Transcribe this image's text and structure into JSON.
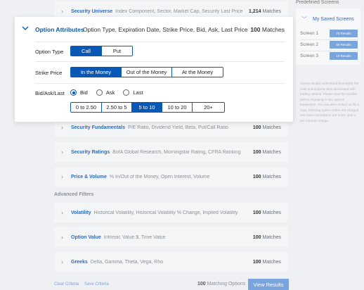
{
  "background_rows": [
    {
      "title": "Security Universe",
      "desc": "Index Component, Sector, Market Cap, Security Last Price",
      "count": "1,214",
      "count_label": "Matches"
    },
    {
      "title": "Security Fundamentals",
      "desc": "P/E Ratio, Dividend Yield, Beta, Put/Call Ratio",
      "count": "100",
      "count_label": "Matches"
    },
    {
      "title": "Security Ratings",
      "desc": "BofA Global Research, Morningstar Rating, CFRA Ranking",
      "count": "100",
      "count_label": "Matches"
    },
    {
      "title": "Price & Volume",
      "desc": "% In/Out of the Money, Open Interest, Volume",
      "count": "100",
      "count_label": "Matches"
    }
  ],
  "advanced_label": "Advanced Filters",
  "advanced_rows": [
    {
      "title": "Volatility",
      "desc": "Historical Volatility, Historical Volatility % Change, Implied Volatility",
      "count": "100",
      "count_label": "Matches"
    },
    {
      "title": "Option Value",
      "desc": "Intrinsic Value $, Time Value",
      "count": "100",
      "count_label": "Matches"
    },
    {
      "title": "Greeks",
      "desc": "Delta, Gamma, Theta, Vega, Rho",
      "count": "100",
      "count_label": "Matches"
    }
  ],
  "sidebar": {
    "title": "Predefined Screens",
    "saved_title": "My Saved Screens",
    "screens": [
      {
        "label": "Screen 1",
        "badge": "70 Results"
      },
      {
        "label": "Screen 2",
        "badge": "50 Results"
      },
      {
        "label": "Screen 3",
        "badge": "10 Results"
      }
    ],
    "disclaimer": "Clients should understand thoroughly the risks and opportunities associated with trading options. Please read the booklet before engaging in any options transaction. You can also contact us for a copy. Multi-leg option orders are charged one base commission per order, plus a per-contract charge."
  },
  "footer": {
    "clear": "Clear Criteria",
    "save": "Save Criteria",
    "matching_count": "100",
    "matching_label": "Matching Options",
    "view_button": "View Results"
  },
  "modal": {
    "title": "Option Attributes",
    "desc": "Option Type, Expiration Date, Strike Price, Bid, Ask, Last Price",
    "count": "100",
    "count_label": "Matches",
    "option_type": {
      "label": "Option Type",
      "options": [
        "Call",
        "Put"
      ],
      "selected": "Call"
    },
    "strike_price": {
      "label": "Strike Price",
      "options": [
        "In the Money",
        "Out of the Money",
        "At the Money"
      ],
      "selected": "In the Money"
    },
    "bid_ask_last": {
      "label": "Bid/Ask/Last",
      "radios": [
        "Bid",
        "Ask",
        "Last"
      ],
      "selected_radio": "Bid",
      "ranges": [
        "0 to 2.50",
        "2.50 to 5",
        "5 to 10",
        "10 to 20",
        "20+"
      ],
      "selected_range": "5 to 10"
    }
  },
  "colors": {
    "accent": "#0a58b5",
    "accent_light": "#7aa4dc"
  }
}
